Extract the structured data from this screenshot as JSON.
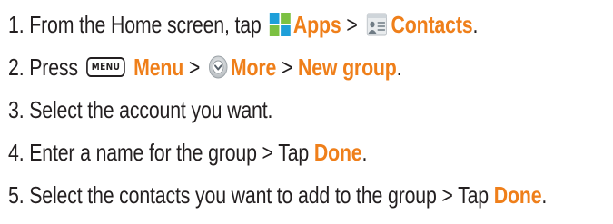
{
  "steps": [
    {
      "number": "1.",
      "text_before": "From the Home screen, tap",
      "apps_label": "Apps",
      "separator": ">",
      "contacts_label": "Contacts",
      "trailing": "."
    },
    {
      "number": "2.",
      "text_before": "Press",
      "menu_key_label": "MENU",
      "menu_label": "Menu",
      "separator": ">",
      "more_label": "More",
      "separator2": ">",
      "new_group_label": "New group",
      "trailing": "."
    },
    {
      "number": "3.",
      "text": "Select the account you want."
    },
    {
      "number": "4.",
      "text_before": "Enter a name for the group > Tap",
      "done_label": "Done",
      "trailing": "."
    },
    {
      "number": "5.",
      "text_before": "Select the contacts you want to add to the group > Tap",
      "done_label": "Done",
      "trailing": "."
    }
  ],
  "icons": {
    "apps": "apps-grid-icon",
    "contacts": "contacts-icon",
    "menu_key": "menu-key-icon",
    "more": "more-icon"
  },
  "colors": {
    "accent": "#ef7f1a",
    "text": "#231f20"
  }
}
